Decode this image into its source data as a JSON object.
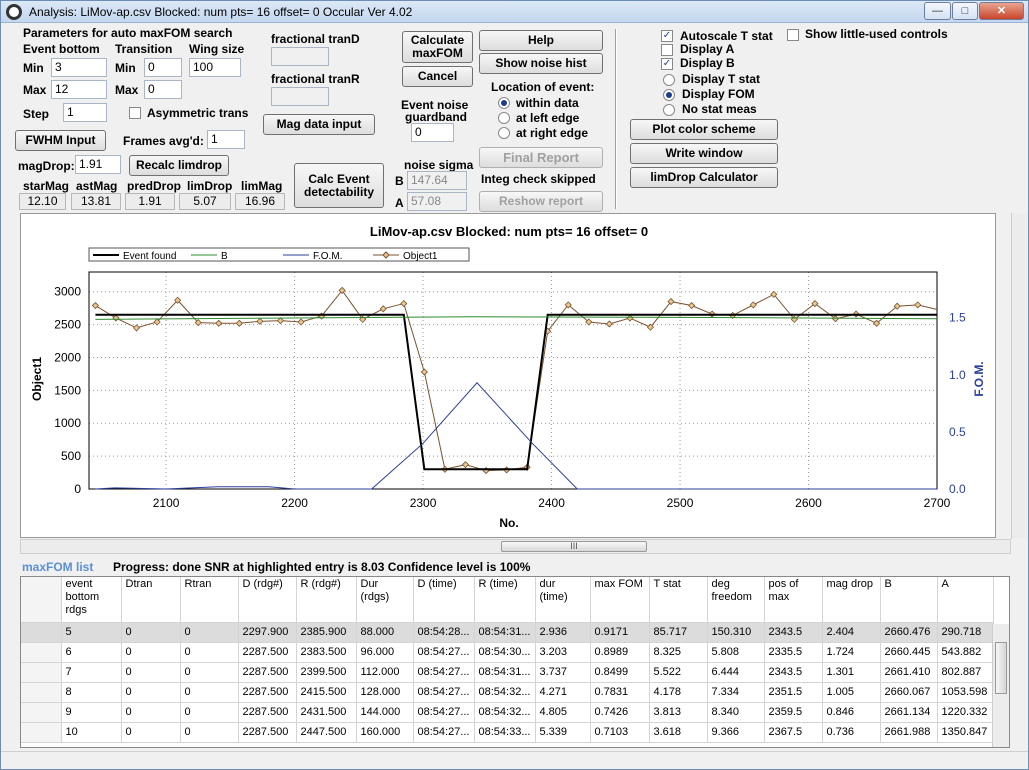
{
  "window": {
    "title": "Analysis: LiMov-ap.csv Blocked: num pts= 16 offset= 0   Occular Ver 4.02",
    "min_label": "—",
    "max_label": "□",
    "close_label": "✕"
  },
  "search": {
    "heading": "Parameters for auto maxFOM search",
    "event_bottom": "Event bottom",
    "transition": "Transition",
    "wing_size": "Wing size",
    "min_label": "Min",
    "max_label": "Max",
    "step_label": "Step",
    "eb_min": "3",
    "eb_max": "12",
    "tr_min": "0",
    "tr_max": "0",
    "wing": "100",
    "step": "1",
    "asymmetric": "Asymmetric trans",
    "fwhm_button": "FWHM Input",
    "frames_label": "Frames avg'd:",
    "frames": "1",
    "magdrop_label": "magDrop:",
    "magdrop": "1.91",
    "recalc_button": "Recalc limdrop"
  },
  "mags": {
    "headers": [
      "starMag",
      "astMag",
      "predDrop",
      "limDrop",
      "limMag"
    ],
    "values": [
      "12.10",
      "13.81",
      "1.91",
      "5.07",
      "16.96"
    ]
  },
  "frac": {
    "tranD": "fractional tranD",
    "tranR": "fractional tranR",
    "mag_button": "Mag data input",
    "calc_button_1": "Calc Event",
    "calc_button_2": "detectability"
  },
  "middle": {
    "calc_max_1": "Calculate",
    "calc_max_2": "maxFOM",
    "cancel": "Cancel",
    "noise_guard_1": "Event noise",
    "noise_guard_2": "guardband",
    "noise_guard": "0",
    "noise_sigma": "noise sigma",
    "b_label": "B",
    "b_val": "147.64",
    "a_label": "A",
    "a_val": "57.08"
  },
  "help": {
    "help_button": "Help",
    "noise_hist_button": "Show noise hist",
    "location_label": "Location of event:",
    "loc_options": [
      "within data",
      "at left edge",
      "at right edge"
    ],
    "final_report": "Final Report",
    "integ_label": "Integ check skipped",
    "reshow": "Reshow report"
  },
  "display": {
    "autoscale": "Autoscale T stat",
    "display_a": "Display A",
    "display_b": "Display B",
    "show_little": "Show little-used controls",
    "radio": [
      "Display T stat",
      "Display FOM",
      "No stat meas"
    ],
    "plot_color": "Plot color scheme",
    "write_window": "Write window",
    "limdrop_calc": "limDrop Calculator"
  },
  "chart_data": {
    "type": "line",
    "title": "LiMov-ap.csv Blocked: num pts= 16 offset= 0",
    "xlabel": "No.",
    "ylabel": "Object1",
    "y2label": "F.O.M.",
    "xlim": [
      2040,
      2700
    ],
    "ylim": [
      0,
      3300
    ],
    "y2lim": [
      0,
      1.9
    ],
    "xticks": [
      2100,
      2200,
      2300,
      2400,
      2500,
      2600,
      2700
    ],
    "yticks": [
      0,
      500,
      1000,
      1500,
      2000,
      2500,
      3000
    ],
    "y2ticks": [
      0.0,
      0.5,
      1.0,
      1.5
    ],
    "grid": true,
    "legend": [
      "Event found",
      "B",
      "F.O.M.",
      "Object1"
    ],
    "series": [
      {
        "name": "Object1",
        "color": "#7a5230",
        "x": [
          2045,
          2061,
          2077,
          2093,
          2109,
          2125,
          2141,
          2157,
          2173,
          2189,
          2205,
          2221,
          2237,
          2253,
          2269,
          2285,
          2301,
          2317,
          2333,
          2349,
          2365,
          2381,
          2397,
          2413,
          2429,
          2445,
          2461,
          2477,
          2493,
          2509,
          2525,
          2541,
          2557,
          2573,
          2589,
          2605,
          2621,
          2637,
          2653,
          2669,
          2685,
          2701
        ],
        "y": [
          2790,
          2600,
          2450,
          2540,
          2870,
          2530,
          2520,
          2520,
          2550,
          2560,
          2540,
          2630,
          3020,
          2580,
          2740,
          2820,
          1780,
          300,
          370,
          280,
          290,
          330,
          2400,
          2800,
          2540,
          2510,
          2600,
          2460,
          2850,
          2790,
          2660,
          2640,
          2800,
          2960,
          2580,
          2820,
          2590,
          2660,
          2520,
          2780,
          2800,
          2730
        ]
      },
      {
        "name": "Event found",
        "color": "#000000",
        "x": [
          2045,
          2285,
          2301,
          2381,
          2397,
          2701
        ],
        "y": [
          2650,
          2650,
          300,
          300,
          2650,
          2650
        ]
      },
      {
        "name": "B",
        "color": "#2e8b2e",
        "x": [
          2045,
          2200,
          2340,
          2500,
          2701
        ],
        "y": [
          2580,
          2600,
          2620,
          2610,
          2590
        ]
      },
      {
        "name": "F.O.M.",
        "color": "#2a3f9d",
        "x": [
          2045,
          2060,
          2100,
          2140,
          2180,
          2200,
          2260,
          2300,
          2342,
          2385,
          2420,
          2460,
          2701
        ],
        "y": [
          0,
          0.01,
          0,
          0.02,
          0.02,
          0,
          0,
          0.4,
          0.93,
          0.4,
          0,
          0,
          0
        ]
      }
    ]
  },
  "scrollbar": {
    "thumb": "III"
  },
  "grid_panel": {
    "maxfom_label": "maxFOM list",
    "progress": "Progress: done  SNR at highlighted entry is 8.03   Confidence level is   100%",
    "columns": [
      "event bottom rdgs",
      "Dtran",
      "Rtran",
      "D (rdg#)",
      "R (rdg#)",
      "Dur (rdgs)",
      "D (time)",
      "R (time)",
      "dur (time)",
      "max FOM",
      "T stat",
      "deg freedom",
      "pos of max",
      "mag drop",
      "B",
      "A"
    ],
    "rows": [
      [
        "5",
        "0",
        "0",
        "2297.900",
        "2385.900",
        "88.000",
        "08:54:28...",
        "08:54:31...",
        "2.936",
        "0.9171",
        "85.717",
        "150.310",
        "2343.5",
        "2.404",
        "2660.476",
        "290.718"
      ],
      [
        "6",
        "0",
        "0",
        "2287.500",
        "2383.500",
        "96.000",
        "08:54:27...",
        "08:54:30...",
        "3.203",
        "0.8989",
        "8.325",
        "5.808",
        "2335.5",
        "1.724",
        "2660.445",
        "543.882"
      ],
      [
        "7",
        "0",
        "0",
        "2287.500",
        "2399.500",
        "112.000",
        "08:54:27...",
        "08:54:31...",
        "3.737",
        "0.8499",
        "5.522",
        "6.444",
        "2343.5",
        "1.301",
        "2661.410",
        "802.887"
      ],
      [
        "8",
        "0",
        "0",
        "2287.500",
        "2415.500",
        "128.000",
        "08:54:27...",
        "08:54:32...",
        "4.271",
        "0.7831",
        "4.178",
        "7.334",
        "2351.5",
        "1.005",
        "2660.067",
        "1053.598"
      ],
      [
        "9",
        "0",
        "0",
        "2287.500",
        "2431.500",
        "144.000",
        "08:54:27...",
        "08:54:32...",
        "4.805",
        "0.7426",
        "3.813",
        "8.340",
        "2359.5",
        "0.846",
        "2661.134",
        "1220.332"
      ],
      [
        "10",
        "0",
        "0",
        "2287.500",
        "2447.500",
        "160.000",
        "08:54:27...",
        "08:54:33...",
        "5.339",
        "0.7103",
        "3.618",
        "9.366",
        "2367.5",
        "0.736",
        "2661.988",
        "1350.847"
      ]
    ]
  }
}
